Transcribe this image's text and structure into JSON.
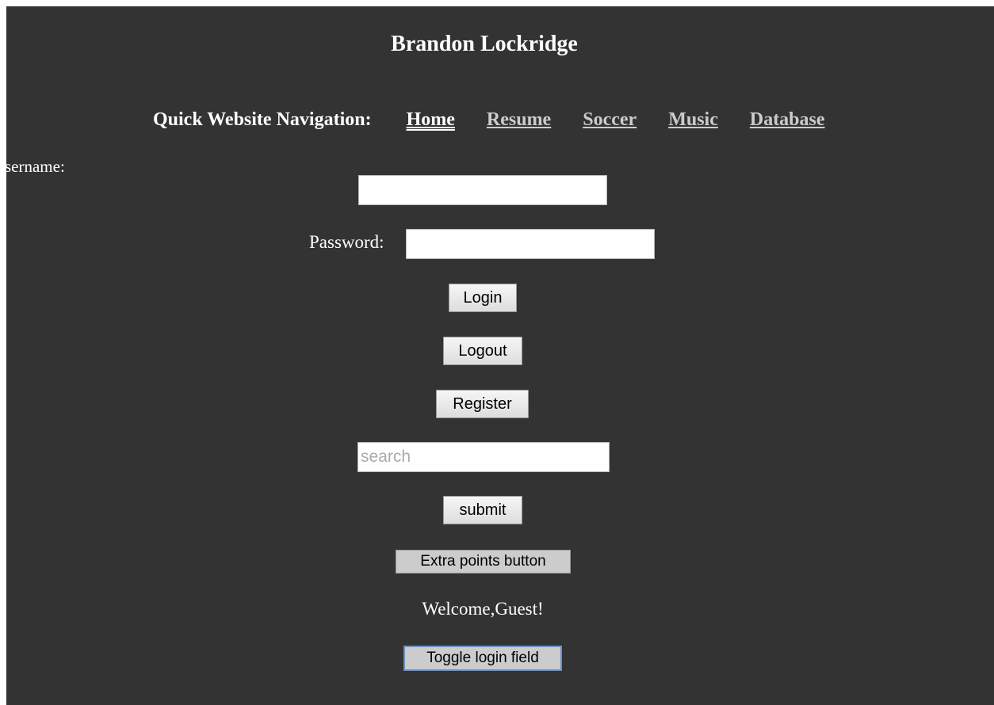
{
  "header": {
    "title": "Brandon Lockridge"
  },
  "nav": {
    "label": "Quick Website Navigation:",
    "links": [
      {
        "label": "Home"
      },
      {
        "label": "Resume"
      },
      {
        "label": "Soccer"
      },
      {
        "label": "Music"
      },
      {
        "label": "Database"
      }
    ],
    "active": "Home"
  },
  "login": {
    "username_label": "sername:",
    "username_value": "",
    "password_label": "Password:",
    "password_value": "",
    "login_label": "Login",
    "logout_label": "Logout",
    "register_label": "Register"
  },
  "search": {
    "placeholder": "search",
    "value": "",
    "submit_label": "submit"
  },
  "extra": {
    "extra_points_label": "Extra points button",
    "welcome_text": "Welcome,Guest!",
    "toggle_label": "Toggle login field"
  },
  "colors": {
    "background": "#333333",
    "text": "#ffffff",
    "link": "#cccccc"
  }
}
